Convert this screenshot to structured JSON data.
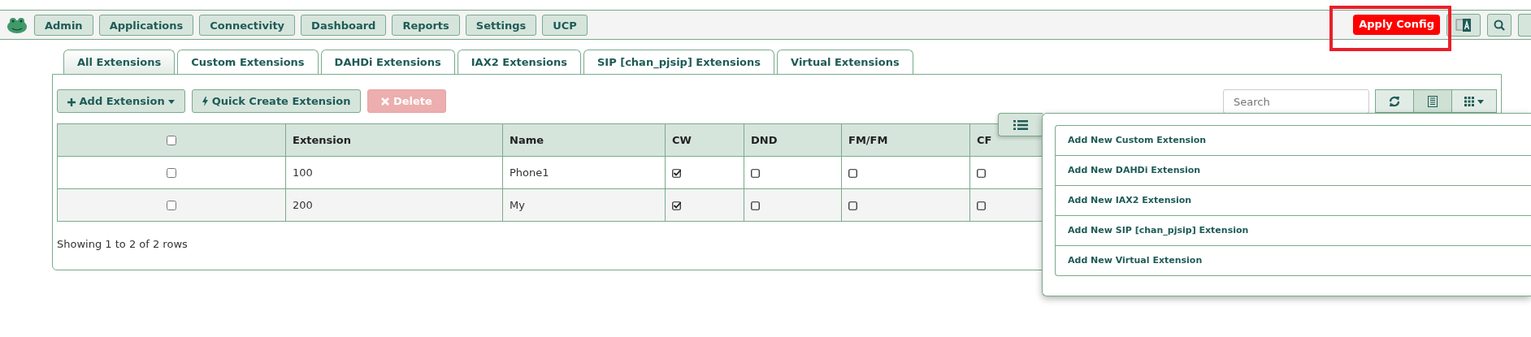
{
  "nav": {
    "menus": [
      {
        "label": "Admin"
      },
      {
        "label": "Applications"
      },
      {
        "label": "Connectivity"
      },
      {
        "label": "Dashboard"
      },
      {
        "label": "Reports"
      },
      {
        "label": "Settings"
      },
      {
        "label": "UCP"
      }
    ],
    "apply_config": {
      "label": "Apply Config",
      "highlighted": true
    }
  },
  "tabs": [
    {
      "label": "All Extensions",
      "selected": true
    },
    {
      "label": "Custom Extensions",
      "selected": false
    },
    {
      "label": "DAHDi Extensions",
      "selected": false
    },
    {
      "label": "IAX2 Extensions",
      "selected": false
    },
    {
      "label": "SIP [chan_pjsip] Extensions",
      "selected": false
    },
    {
      "label": "Virtual Extensions",
      "selected": false
    }
  ],
  "toolbar": {
    "add": "Add Extension",
    "quick_create": "Quick Create Extension",
    "delete": {
      "label": "Delete",
      "disabled": true
    },
    "search": {
      "placeholder": "Search"
    }
  },
  "table": {
    "header_checked": false,
    "columns": [
      "Extension",
      "Name",
      "CW",
      "DND",
      "FM/FM",
      "CF"
    ],
    "rows": [
      {
        "selected": false,
        "extension": "100",
        "name": "Phone1",
        "cw": true,
        "dnd": false,
        "fmfm": false,
        "cf": false
      },
      {
        "selected": false,
        "extension": "200",
        "name": "My",
        "cw": true,
        "dnd": false,
        "fmfm": false,
        "cf": false
      }
    ]
  },
  "footer": "Showing 1 to 2 of 2 rows",
  "dropdown": {
    "items": [
      "Add New Custom Extension",
      "Add New DAHDi Extension",
      "Add New IAX2 Extension",
      "Add New SIP [chan_pjsip] Extension",
      "Add New Virtual Extension"
    ]
  }
}
